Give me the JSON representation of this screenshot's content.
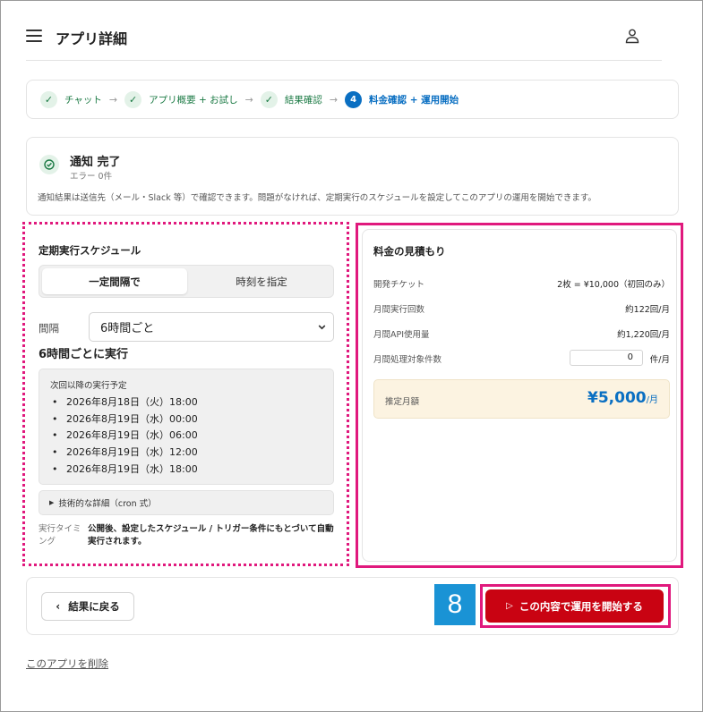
{
  "header": {
    "title": "アプリ詳細",
    "menu_icon": "hamburger-menu-icon",
    "user_icon": "user-icon"
  },
  "stepper": {
    "steps": [
      {
        "label": "チャット",
        "marker": "✓"
      },
      {
        "label": "アプリ概要 + お試し",
        "marker": "✓"
      },
      {
        "label": "結果確認",
        "marker": "✓"
      },
      {
        "label": "料金確認 + 運用開始",
        "marker": "4"
      }
    ],
    "separator": "→"
  },
  "notify": {
    "title": "通知 完了",
    "sub": "エラー 0件",
    "description": "通知結果は送信先（メール・Slack 等）で確認できます。問題がなければ、定期実行のスケジュールを設定してこのアプリの運用を開始できます。"
  },
  "schedule": {
    "title": "定期実行スケジュール",
    "mode_interval": "一定間隔で",
    "mode_time": "時刻を指定",
    "interval_label": "間隔",
    "interval_value": "6時間ごと",
    "run_title": "6時間ごとに実行",
    "next_label": "次回以降の実行予定",
    "next_runs": [
      "2026年8月18日（火）18:00",
      "2026年8月19日（水）00:00",
      "2026年8月19日（水）06:00",
      "2026年8月19日（水）12:00",
      "2026年8月19日（水）18:00"
    ],
    "tech_details": "技術的な詳細（cron 式）",
    "timing_label": "実行タイミング",
    "timing_text": "公開後、設定したスケジュール / トリガー条件にもとづいて自動実行されます。"
  },
  "estimate": {
    "title": "料金の見積もり",
    "rows": [
      {
        "label": "開発チケット",
        "value": "2枚 = ¥10,000（初回のみ）"
      },
      {
        "label": "月間実行回数",
        "value": "約122回/月"
      },
      {
        "label": "月間API使用量",
        "value": "約1,220回/月"
      },
      {
        "label": "月間処理対象件数",
        "value": "0",
        "unit": "件/月"
      }
    ],
    "total_label": "推定月額",
    "total_value": "¥5,000",
    "total_unit": "/月"
  },
  "footer": {
    "back_label": "結果に戻る",
    "badge": "8",
    "start_label": "この内容で運用を開始する"
  },
  "delete_link": "このアプリを削除",
  "colors": {
    "accent_green": "#1b7a44",
    "accent_blue": "#0a6fc2",
    "primary_red": "#c90312",
    "highlight_magenta": "#e0197d",
    "badge_blue": "#1a93d5"
  }
}
